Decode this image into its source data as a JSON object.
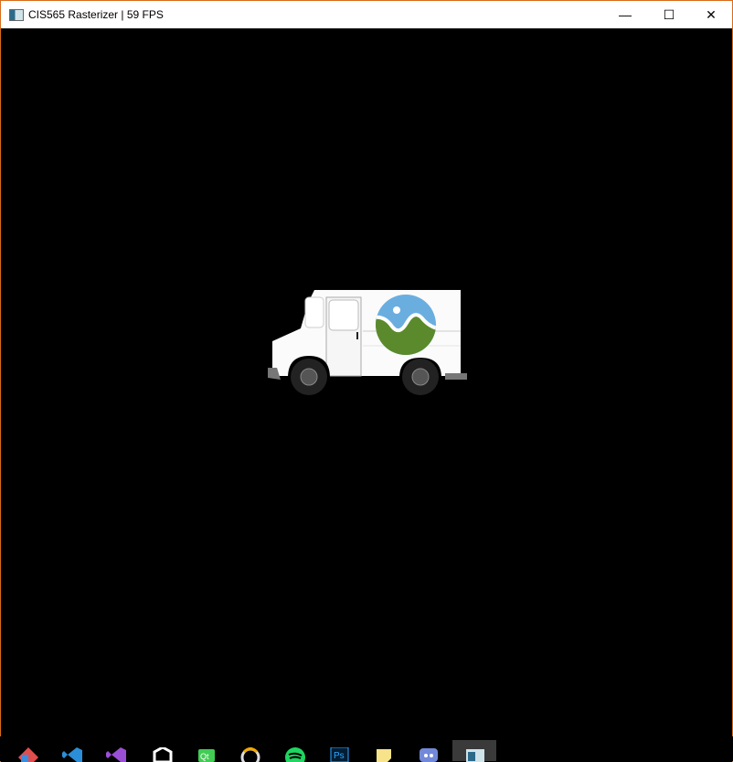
{
  "window": {
    "title": "CIS565 Rasterizer | 59 FPS",
    "border_color": "#d96b1a",
    "controls": {
      "minimize": "—",
      "maximize": "☐",
      "close": "✕"
    }
  },
  "taskbar": {
    "apps": [
      "git-client-icon",
      "vscode-icon",
      "visual-studio-icon",
      "unity-icon",
      "qt-creator-icon",
      "overwatch-icon",
      "spotify-icon",
      "photoshop-icon",
      "sticky-notes-icon",
      "discord-icon",
      "rasterizer-app-icon"
    ],
    "active_index": 10,
    "photoshop_label": "Ps",
    "qt_label": "Qt"
  }
}
